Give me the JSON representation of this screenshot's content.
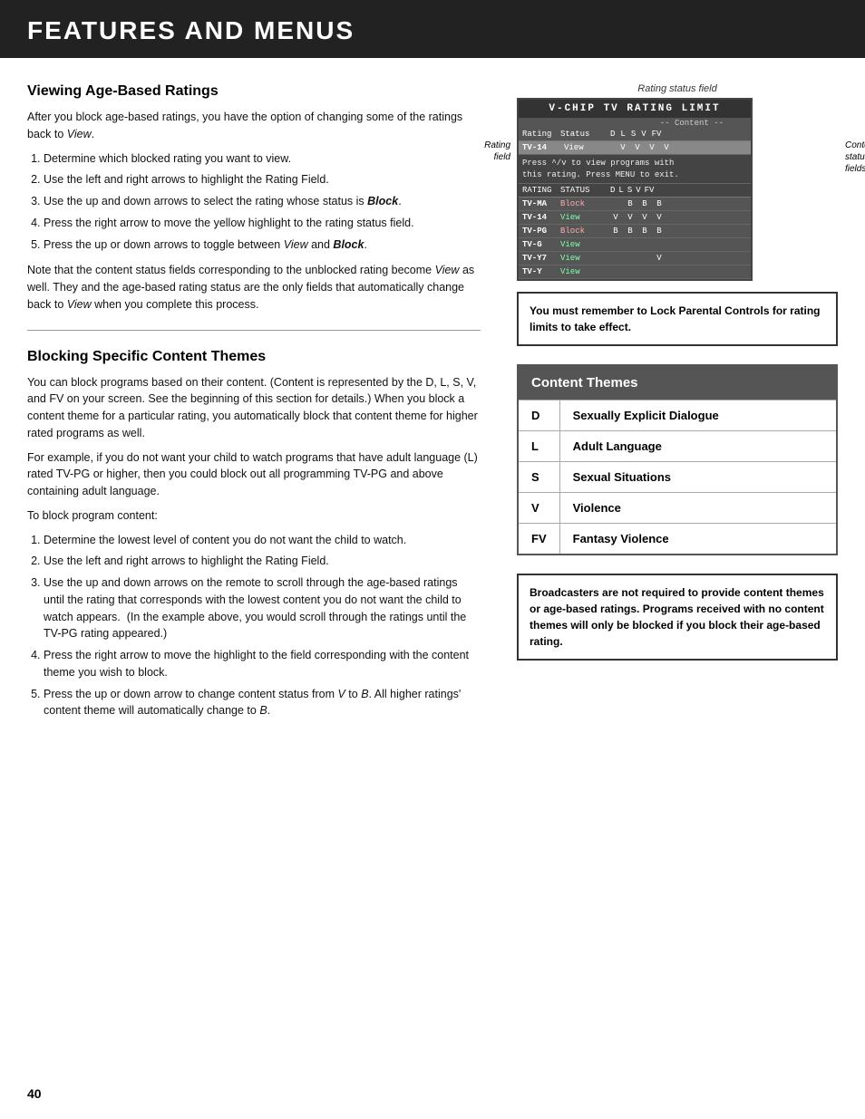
{
  "header": {
    "title": "Features and Menus"
  },
  "section1": {
    "title": "Viewing Age-Based Ratings",
    "intro": "After you block age-based ratings, you have the option of changing some of the ratings back to View.",
    "steps": [
      "Determine which blocked rating you want to view.",
      "Use the left and right arrows to highlight the Rating Field.",
      "Use the up and down arrows to select the rating whose status is Block.",
      "Press the right arrow to move the yellow highlight to the rating status field.",
      "Press the up or down arrows to toggle between View and Block."
    ],
    "note": "Note that the content status fields corresponding to the unblocked rating become View as well. They and the age-based rating status are the only fields that automatically change back to View when you complete this process.",
    "notice": "You must remember to Lock Parental Controls for rating limits to take effect."
  },
  "section2": {
    "title": "Blocking Specific Content Themes",
    "para1": "You can block programs based on their content. (Content is represented by the D, L, S, V, and FV on your screen. See the beginning of this section for details.) When you block a content theme for a particular rating, you automatically block that content theme for higher rated programs as well.",
    "para2": "For example, if you do not want your child to watch programs that have adult language (L) rated TV-PG or higher, then you could block out all programming TV-PG and above containing adult language.",
    "para3": "To block program content:",
    "steps": [
      "Determine the lowest level of content you do not want the child to watch.",
      "Use the left and right arrows to highlight the Rating Field.",
      "Use the up and down arrows on the remote to scroll through the age-based ratings until the rating that corresponds with the lowest content you do not want the child to watch appears.  (In the example above, you would scroll through the ratings until the TV-PG rating appeared.)",
      "Press the right arrow to move the highlight to the field corresponding with the content theme you wish to block.",
      "Press the up or down arrow to change content status from V to B. All higher ratings' content theme will automatically change to B."
    ],
    "notice2": "Broadcasters are not required to provide content themes or age-based ratings. Programs received with no content themes will only be blocked if you block their age-based rating."
  },
  "vchip_diagram": {
    "rating_status_label": "Rating status field",
    "title": "V-CHIP  TV  RATING  LIMIT",
    "content_label": "-- Content --",
    "col_headers": [
      "Rating",
      "Status",
      "D",
      "L",
      "S",
      "V",
      "FV"
    ],
    "highlighted_row": {
      "rating": "TV-14",
      "status": "View",
      "d": "V",
      "l": "V",
      "s": "V",
      "v": "V",
      "fv": ""
    },
    "note": "Press ^/v to view programs with this rating. Press MENU to exit.",
    "sub_col_headers": [
      "RATING",
      "STATUS",
      "D",
      "L",
      "S",
      "V",
      "FV"
    ],
    "rows": [
      {
        "rating": "TV-MA",
        "status": "Block",
        "d": "",
        "l": "B",
        "s": "B",
        "v": "B",
        "fv": ""
      },
      {
        "rating": "TV-14",
        "status": "View",
        "d": "V",
        "l": "V",
        "s": "V",
        "v": "V",
        "fv": ""
      },
      {
        "rating": "TV-PG",
        "status": "Block",
        "d": "B",
        "l": "B",
        "s": "B",
        "v": "B",
        "fv": ""
      },
      {
        "rating": "TV-G",
        "status": "View",
        "d": "",
        "l": "",
        "s": "",
        "v": "",
        "fv": ""
      },
      {
        "rating": "TV-Y7",
        "status": "View",
        "d": "",
        "l": "",
        "s": "",
        "v": "V",
        "fv": ""
      },
      {
        "rating": "TV-Y",
        "status": "View",
        "d": "",
        "l": "",
        "s": "",
        "v": "",
        "fv": ""
      }
    ],
    "label_rating_field": "Rating field",
    "label_content_status": "Content status fields."
  },
  "content_themes": {
    "title": "Content Themes",
    "rows": [
      {
        "code": "D",
        "label": "Sexually Explicit Dialogue"
      },
      {
        "code": "L",
        "label": "Adult Language"
      },
      {
        "code": "S",
        "label": "Sexual Situations"
      },
      {
        "code": "V",
        "label": "Violence"
      },
      {
        "code": "FV",
        "label": "Fantasy Violence"
      }
    ]
  },
  "page_number": "40"
}
